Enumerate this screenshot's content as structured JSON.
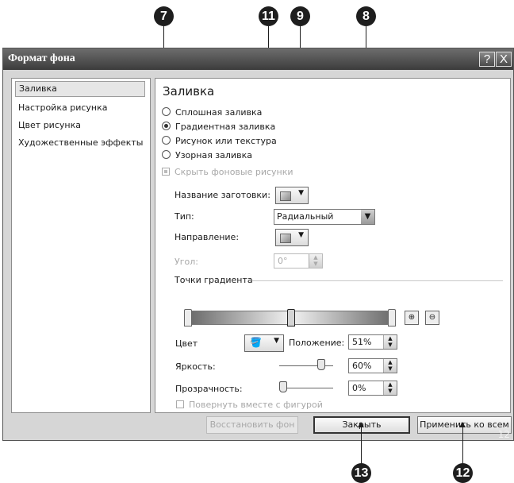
{
  "window": {
    "title": "Формат фона",
    "help_label": "?",
    "close_label": "X"
  },
  "sidebar": {
    "items": [
      {
        "label": "Заливка"
      },
      {
        "label": "Настройка рисунка"
      },
      {
        "label": "Цвет рисунка"
      },
      {
        "label": "Художественные эффекты"
      }
    ]
  },
  "fill": {
    "heading": "Заливка",
    "options": [
      {
        "label": "Сплошная заливка",
        "selected": false
      },
      {
        "label": "Градиентная заливка",
        "selected": true
      },
      {
        "label": "Рисунок или текстура",
        "selected": false
      },
      {
        "label": "Узорная заливка",
        "selected": false
      }
    ],
    "hide_bg_label": "Скрыть фоновые рисунки",
    "preset_label": "Название заготовки:",
    "type_label": "Тип:",
    "type_value": "Радиальный",
    "direction_label": "Направление:",
    "angle_label": "Угол:",
    "angle_value": "0°",
    "stops_label": "Точки градиента",
    "color_label": "Цвет",
    "position_label": "Положение:",
    "position_value": "51%",
    "brightness_label": "Яркость:",
    "brightness_value": "60%",
    "transparency_label": "Прозрачность:",
    "transparency_value": "0%",
    "rotate_label": "Повернуть вместе с фигурой"
  },
  "buttons": {
    "reset": "Восстановить фон",
    "close": "Закрыть",
    "apply_all": "Применить ко всем"
  },
  "callouts": {
    "c7": "7",
    "c11": "11",
    "c9": "9",
    "c8": "8",
    "c13": "13",
    "c12": "12",
    "corner": "12"
  }
}
